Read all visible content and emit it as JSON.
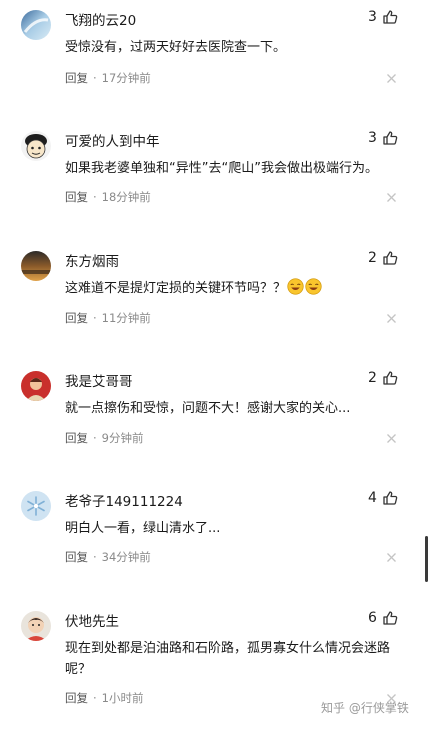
{
  "comments": [
    {
      "username": "飞翔的云20",
      "likes": "3",
      "text": "受惊没有，过两天好好去医院查一下。",
      "reply_label": "回复",
      "time": "17分钟前"
    },
    {
      "username": "可爱的人到中年",
      "likes": "3",
      "text": "如果我老婆单独和“异性”去“爬山”我会做出极端行为。",
      "reply_label": "回复",
      "time": "18分钟前"
    },
    {
      "username": "东方烟雨",
      "likes": "2",
      "text": "这难道不是提灯定损的关键环节吗？？",
      "reply_label": "回复",
      "time": "11分钟前"
    },
    {
      "username": "我是艾哥哥",
      "likes": "2",
      "text": "就一点擦伤和受惊，问题不大！感谢大家的关心...",
      "reply_label": "回复",
      "time": "9分钟前"
    },
    {
      "username": "老爷子149111224",
      "likes": "4",
      "text": "明白人一看，绿山清水了...",
      "reply_label": "回复",
      "time": "34分钟前"
    },
    {
      "username": "伏地先生",
      "likes": "6",
      "text": "现在到处都是泊油路和石阶路，孤男寡女什么情况会迷路呢？",
      "reply_label": "回复",
      "time": "1小时前"
    }
  ],
  "icons": {
    "like": "thumbs-up-icon",
    "close": "close-icon",
    "emoji": "laughing-emoji-icon"
  },
  "watermark": "知乎 @行侠掌铁"
}
